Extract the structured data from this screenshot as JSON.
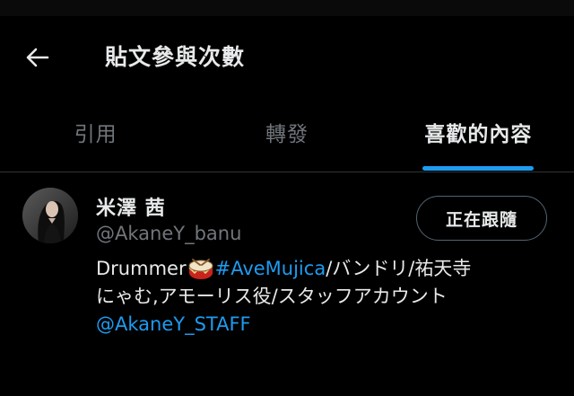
{
  "header": {
    "title": "貼文參與次數",
    "back_icon": "arrow-left-icon"
  },
  "tabs": [
    {
      "label": "引用",
      "active": false
    },
    {
      "label": "轉發",
      "active": false
    },
    {
      "label": "喜歡的內容",
      "active": true
    }
  ],
  "user": {
    "display_name": "米澤 茜",
    "handle": "@AkaneY_banu",
    "follow_label": "正在跟隨",
    "bio": {
      "prefix": "Drummer",
      "icon": "drum-icon",
      "hashtag": "#AveMujica",
      "line1_rest": "/バンドリ/祐天寺",
      "line2": "にゃむ,アモーリス役/スタッフアカウント",
      "mention": "@AkaneY_STAFF"
    }
  },
  "colors": {
    "background": "#000000",
    "accent": "#1d9bf0",
    "primary_text": "#e7e9ea",
    "secondary_text": "#71767b",
    "divider": "#2f3336"
  }
}
